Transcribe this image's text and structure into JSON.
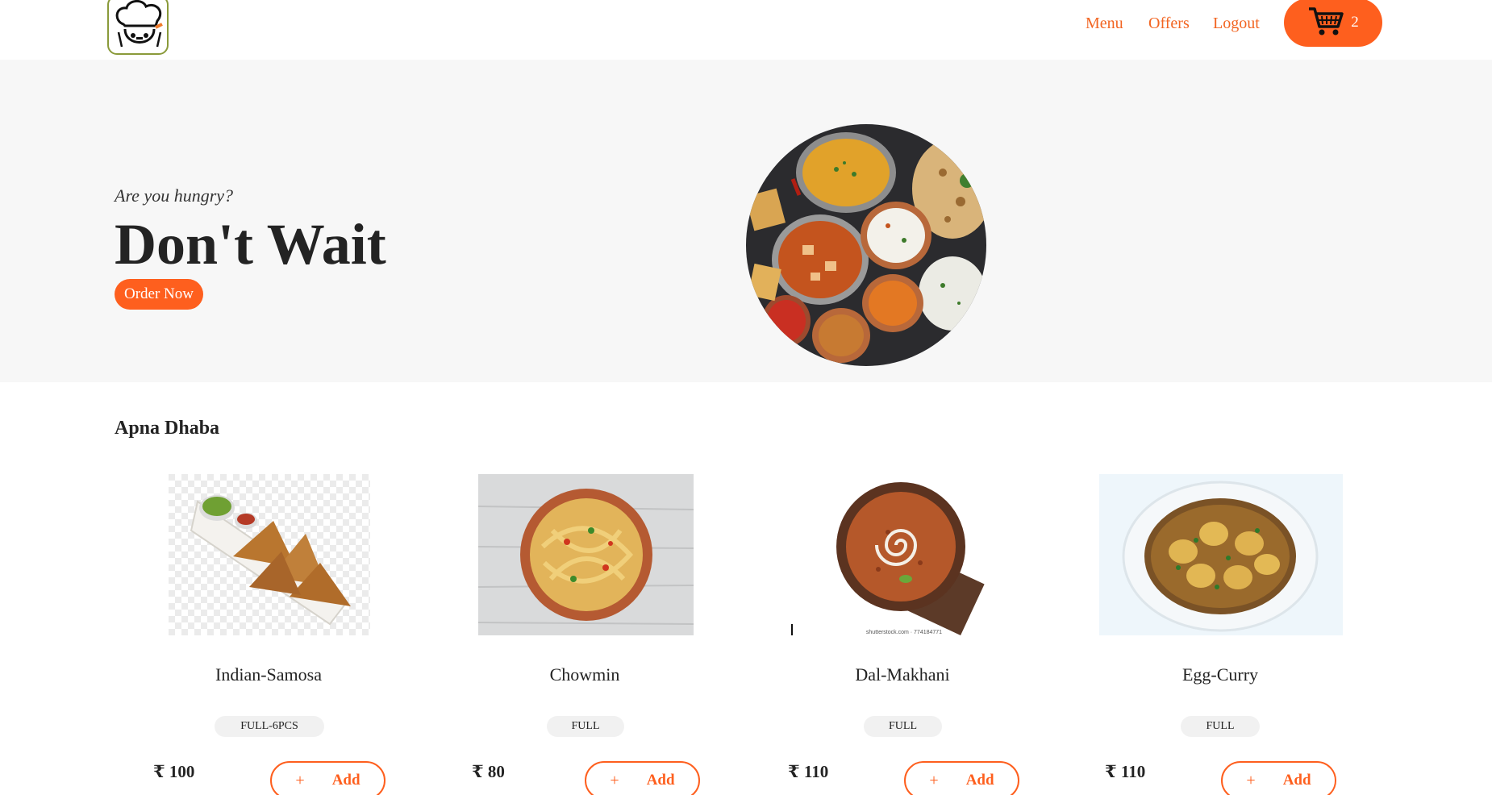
{
  "nav": {
    "menu": "Menu",
    "offers": "Offers",
    "logout": "Logout",
    "cart_count": "2"
  },
  "hero": {
    "subtitle": "Are you hungry?",
    "title": "Don't Wait",
    "order_button": "Order Now"
  },
  "section": {
    "title": "Apna Dhaba"
  },
  "products": [
    {
      "name": "Indian-Samosa",
      "size": "FULL-6PCS",
      "price": "₹ 100",
      "add_plus": "+",
      "add_label": "Add"
    },
    {
      "name": "Chowmin",
      "size": "FULL",
      "price": "₹ 80",
      "add_plus": "+",
      "add_label": "Add"
    },
    {
      "name": "Dal-Makhani",
      "size": "FULL",
      "price": "₹ 110",
      "add_plus": "+",
      "add_label": "Add"
    },
    {
      "name": "Egg-Curry",
      "size": "FULL",
      "price": "₹ 110",
      "add_plus": "+",
      "add_label": "Add"
    }
  ],
  "image_captions": {
    "dal_watermark": "shutterstock.com · 774184771"
  },
  "colors": {
    "accent": "#fe5f1e",
    "nav_link": "#f26522",
    "hero_bg": "#f7f7f7"
  },
  "icons": [
    "chef-logo-icon",
    "cart-icon",
    "plus-icon"
  ]
}
